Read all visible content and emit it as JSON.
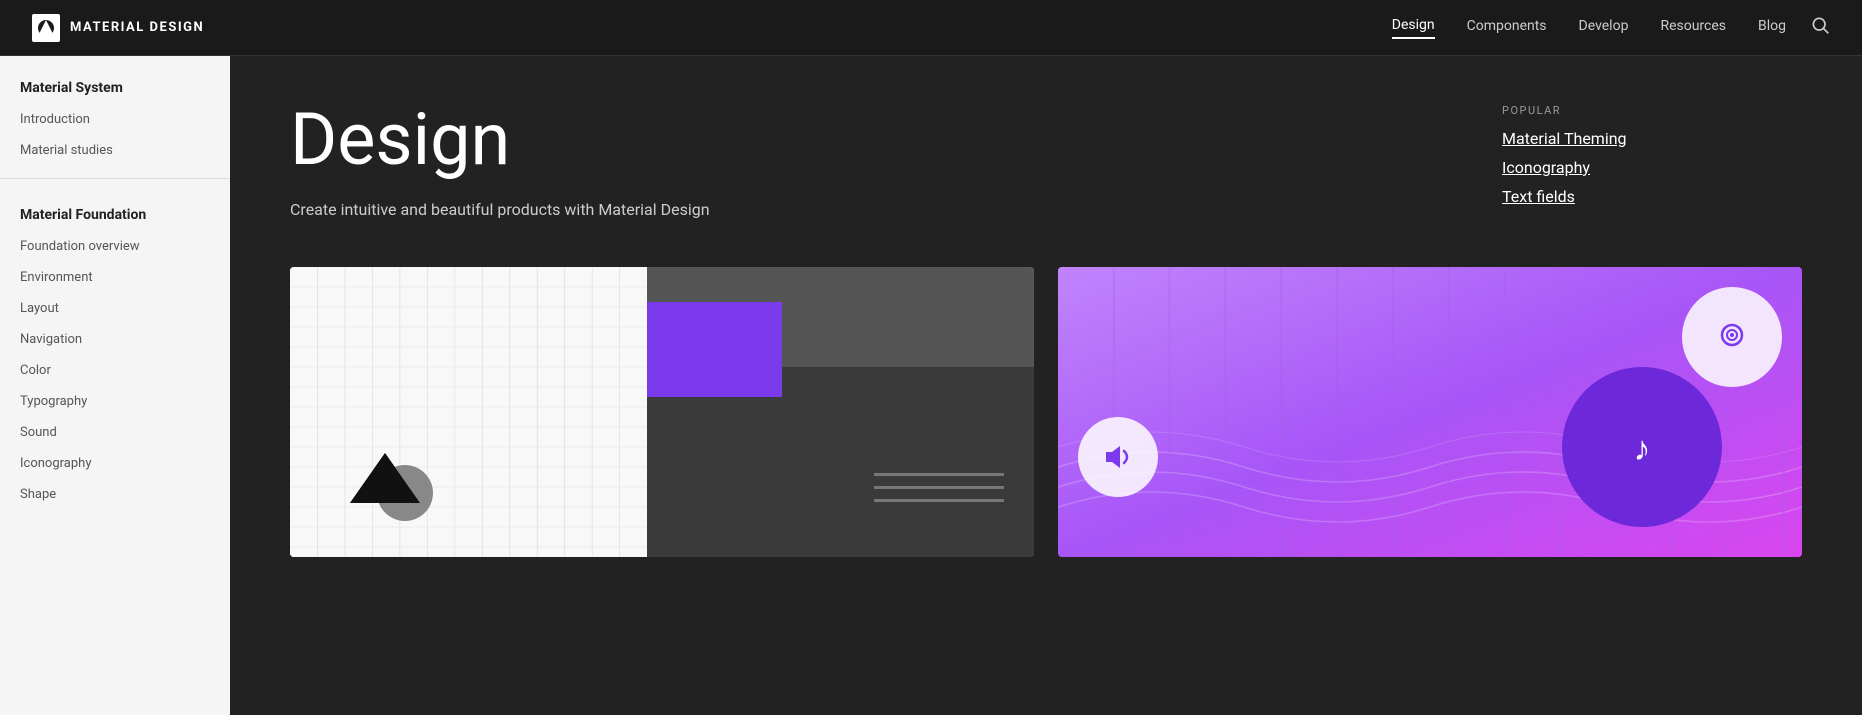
{
  "app": {
    "logo_text": "MATERIAL DESIGN",
    "logo_icon": "material-logo"
  },
  "nav": {
    "links": [
      {
        "label": "Design",
        "active": true
      },
      {
        "label": "Components",
        "active": false
      },
      {
        "label": "Develop",
        "active": false
      },
      {
        "label": "Resources",
        "active": false
      },
      {
        "label": "Blog",
        "active": false
      }
    ],
    "search_icon": "search"
  },
  "sidebar": {
    "sections": [
      {
        "title": "Material System",
        "items": [
          "Introduction",
          "Material studies"
        ]
      },
      {
        "title": "Material Foundation",
        "items": [
          "Foundation overview",
          "Environment",
          "Layout",
          "Navigation",
          "Color",
          "Typography",
          "Sound",
          "Iconography",
          "Shape"
        ]
      }
    ]
  },
  "hero": {
    "title": "Design",
    "subtitle": "Create intuitive and beautiful products with Material Design"
  },
  "popular": {
    "label": "POPULAR",
    "links": [
      "Material Theming",
      "Iconography",
      "Text fields"
    ]
  },
  "cards": [
    {
      "id": "design-card",
      "type": "layout"
    },
    {
      "id": "music-card",
      "type": "sound"
    }
  ]
}
